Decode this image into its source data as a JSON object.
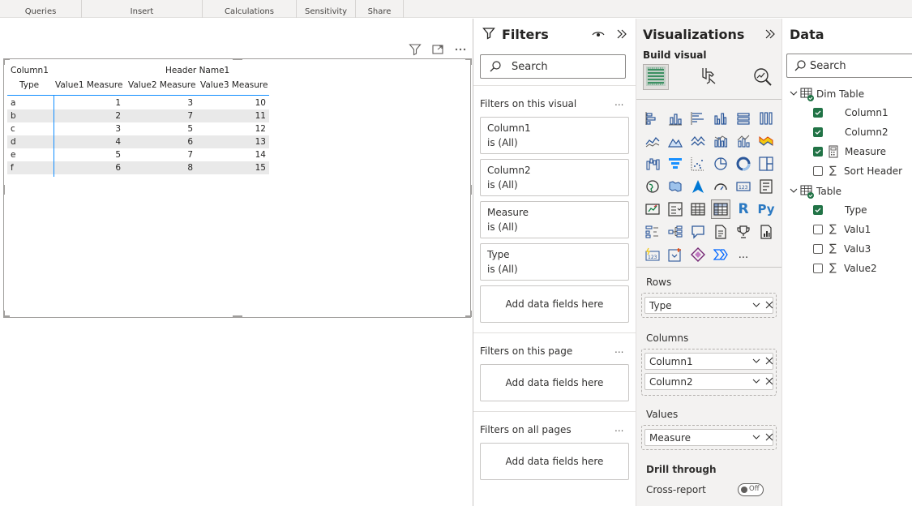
{
  "ribbon": {
    "groups": [
      {
        "label": "Queries"
      },
      {
        "label": "Insert"
      },
      {
        "label": "Calculations"
      },
      {
        "label": "Sensitivity"
      },
      {
        "label": "Share"
      }
    ]
  },
  "matrix": {
    "corner_header": "Column1",
    "column_header_1": "Header Name1",
    "row_header": "Type",
    "value_headers": [
      "Value1 Measure",
      "Value2 Measure",
      "Value3 Measure"
    ],
    "rows": [
      {
        "type": "a",
        "v1": "1",
        "v2": "3",
        "v3": "10"
      },
      {
        "type": "b",
        "v1": "2",
        "v2": "7",
        "v3": "11"
      },
      {
        "type": "c",
        "v1": "3",
        "v2": "5",
        "v3": "12"
      },
      {
        "type": "d",
        "v1": "4",
        "v2": "6",
        "v3": "13"
      },
      {
        "type": "e",
        "v1": "5",
        "v2": "7",
        "v3": "14"
      },
      {
        "type": "f",
        "v1": "6",
        "v2": "8",
        "v3": "15"
      }
    ]
  },
  "filters": {
    "title": "Filters",
    "search_placeholder": "Search",
    "section_visual": "Filters on this visual",
    "section_page": "Filters on this page",
    "section_all": "Filters on all pages",
    "more": "...",
    "cards": [
      {
        "field": "Column1",
        "state": "is (All)"
      },
      {
        "field": "Column2",
        "state": "is (All)"
      },
      {
        "field": "Measure",
        "state": "is (All)"
      },
      {
        "field": "Type",
        "state": "is (All)"
      }
    ],
    "add_label": "Add data fields here"
  },
  "visualizations": {
    "title": "Visualizations",
    "build_label": "Build visual",
    "more_visuals": "...",
    "rows_label": "Rows",
    "rows_fields": [
      "Type"
    ],
    "columns_label": "Columns",
    "columns_fields": [
      "Column1",
      "Column2"
    ],
    "values_label": "Values",
    "values_fields": [
      "Measure"
    ],
    "drill_label": "Drill through",
    "cross_report_label": "Cross-report",
    "toggle_state": "Off",
    "r_label": "R",
    "py_label": "Py"
  },
  "data_pane": {
    "title": "Data",
    "search_placeholder": "Search",
    "tables": [
      {
        "name": "Dim Table",
        "fields": [
          {
            "name": "Column1",
            "checked": true,
            "kind": "field"
          },
          {
            "name": "Column2",
            "checked": true,
            "kind": "field"
          },
          {
            "name": "Measure",
            "checked": true,
            "kind": "measure"
          },
          {
            "name": "Sort Header",
            "checked": false,
            "kind": "sum"
          }
        ]
      },
      {
        "name": "Table",
        "fields": [
          {
            "name": "Type",
            "checked": true,
            "kind": "field"
          },
          {
            "name": "Valu1",
            "checked": false,
            "kind": "sum"
          },
          {
            "name": "Valu3",
            "checked": false,
            "kind": "sum"
          },
          {
            "name": "Value2",
            "checked": false,
            "kind": "sum"
          }
        ]
      }
    ]
  },
  "colors": {
    "accent": "#118dff",
    "check": "#217346",
    "pane_bg": "#f3f2f1"
  }
}
